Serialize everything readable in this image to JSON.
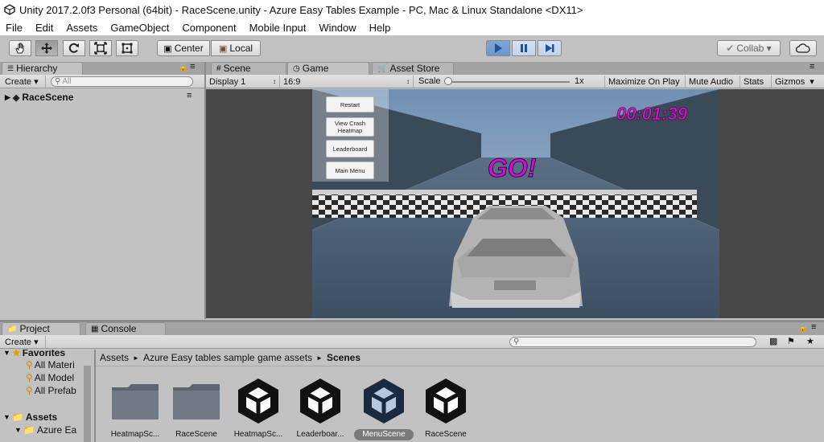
{
  "window": {
    "title": "Unity 2017.2.0f3 Personal (64bit) - RaceScene.unity - Azure Easy Tables Example - PC, Mac & Linux Standalone <DX11>"
  },
  "menu": [
    "File",
    "Edit",
    "Assets",
    "GameObject",
    "Component",
    "Mobile Input",
    "Window",
    "Help"
  ],
  "toolbar": {
    "tools": [
      "hand-tool",
      "move-tool",
      "rotate-tool",
      "scale-tool",
      "rect-tool"
    ],
    "pivot": "Center",
    "space": "Local",
    "collab": "Collab ▾",
    "play_state": "playing"
  },
  "hierarchy": {
    "tab": "Hierarchy",
    "create": "Create ▾",
    "search_placeholder": "All",
    "scene": "RaceScene"
  },
  "center_tabs": [
    "Scene",
    "Game",
    "Asset Store"
  ],
  "game_bar": {
    "display": "Display 1",
    "aspect": "16:9",
    "scale_label": "Scale",
    "scale_value": "1x",
    "toggles": [
      "Maximize On Play",
      "Mute Audio",
      "Stats",
      "Gizmos"
    ],
    "gizmos_arrow": "▾"
  },
  "game": {
    "buttons": [
      "Restart",
      "View Crash Heatmap",
      "Leaderboard",
      "Main Menu"
    ],
    "timer": "00:01:39",
    "banner": "GO!"
  },
  "bottom_tabs": [
    "Project",
    "Console"
  ],
  "project": {
    "create": "Create ▾",
    "tree": {
      "favorites": "Favorites",
      "favorite_items": [
        "All Materi",
        "All Model",
        "All Prefab"
      ],
      "assets": "Assets",
      "assets_child": "Azure Ea"
    },
    "breadcrumb": [
      "Assets",
      "Azure Easy tables sample game assets",
      "Scenes"
    ],
    "items": [
      {
        "label": "HeatmapSc...",
        "kind": "folder"
      },
      {
        "label": "RaceScene",
        "kind": "folder"
      },
      {
        "label": "HeatmapSc...",
        "kind": "scene"
      },
      {
        "label": "Leaderboar...",
        "kind": "scene"
      },
      {
        "label": "MenuScene",
        "kind": "scene",
        "selected": true
      },
      {
        "label": "RaceScene",
        "kind": "scene"
      }
    ]
  }
}
